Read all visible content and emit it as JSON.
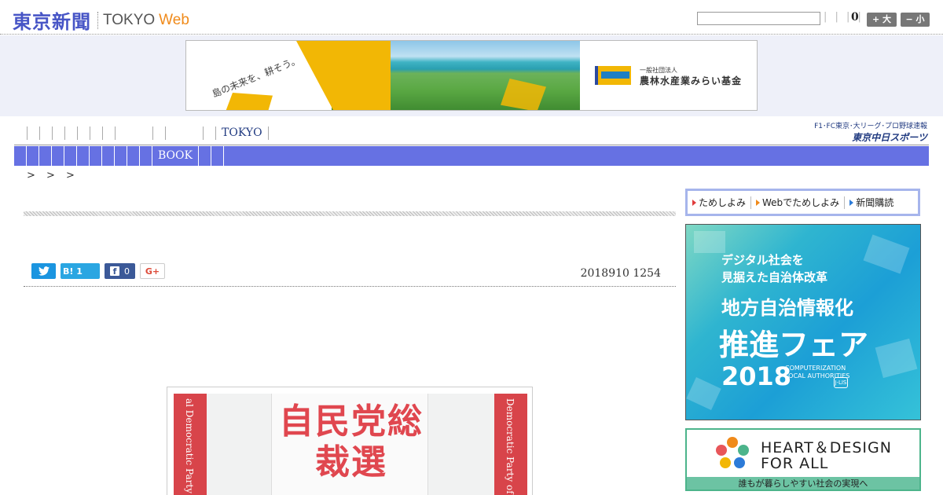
{
  "header": {
    "logo_main": "東京新聞",
    "logo_tokyo": "TOKYO",
    "logo_web": "Web",
    "search_placeholder": "",
    "pipes": "| | | |",
    "count": "0",
    "font_large": "+ 大",
    "font_small": "− 小"
  },
  "top_ad": {
    "copy": "島の未来を、耕そう。",
    "org_sub": "一般社団法人",
    "org_name": "農林水産業みらい基金"
  },
  "nav": {
    "top_label": "TOKYO",
    "bar_label": "BOOK",
    "sports_sub": "F1･FC東京･大リーグ･プロ野球速報",
    "sports_main": "東京中日スポーツ"
  },
  "breadcrumb": "> > >",
  "article": {
    "share_twitter_icon": "twitter-bird",
    "share_hatena": "B! 1",
    "share_facebook_count": "0",
    "share_gplus": "G+",
    "pubdate": "2018910 1254",
    "photo": {
      "band_left": "al Democratic Party",
      "band_right": "Democratic Party of J",
      "board_text": "自民党総裁選"
    }
  },
  "sidebar": {
    "trial": {
      "items": [
        "ためしよみ",
        "Webでためしよみ",
        "新聞購読"
      ]
    },
    "fair_ad": {
      "line1": "デジタル社会を",
      "line2": "見据えた自治体改革",
      "line3": "地方自治情報化",
      "line4": "推進フェア",
      "year": "2018",
      "en": "COMPUTERIZATION LOCAL AUTHORITIES",
      "logo": "J-LIS"
    },
    "heart_ad": {
      "line1": "HEART＆DESIGN",
      "line2": "FOR ALL",
      "footer": "誰もが暮らしやすい社会の実現へ"
    }
  },
  "colors": {
    "brand_blue": "#4755c6",
    "web_orange": "#f08a1a",
    "nav_bar": "#6671e3"
  }
}
